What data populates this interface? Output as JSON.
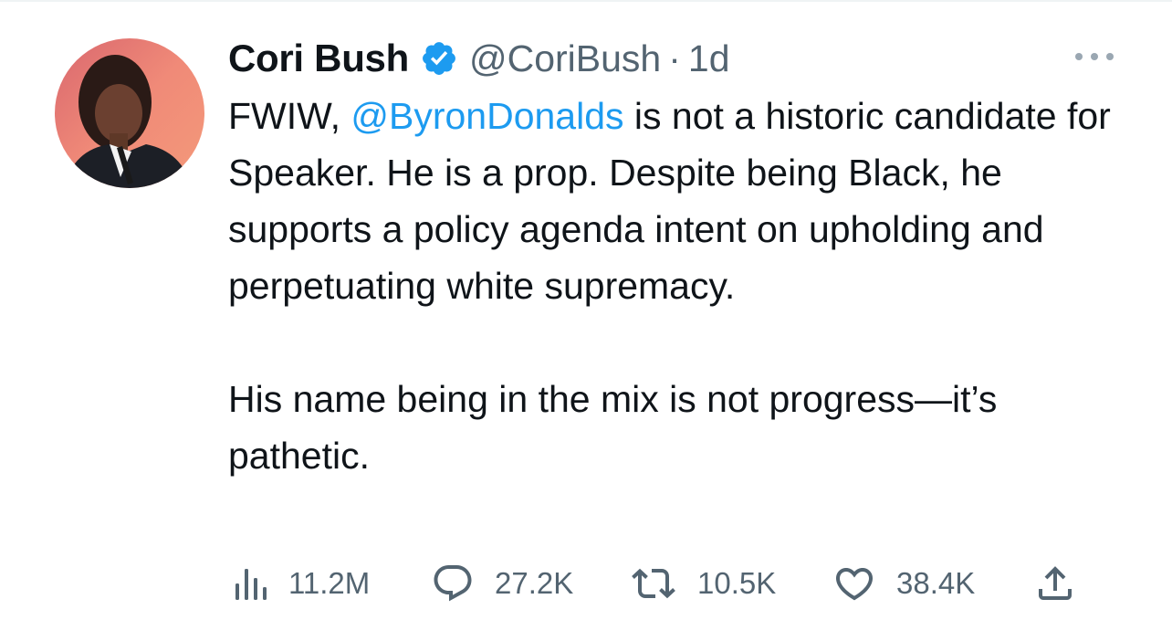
{
  "tweet": {
    "display_name": "Cori Bush",
    "handle": "@CoriBush",
    "separator": "·",
    "time": "1d",
    "text_before_mention": "FWIW, ",
    "mention": "@ByronDonalds",
    "text_after_mention": " is not a historic candidate for Speaker. He is a prop. Despite being Black, he supports a policy agenda intent on upholding and perpetuating white supremacy.",
    "paragraph2": "His name being in the mix is not progress—it’s pathetic."
  },
  "actions": {
    "views": "11.2M",
    "replies": "27.2K",
    "retweets": "10.5K",
    "likes": "38.4K"
  },
  "colors": {
    "text": "#0f1419",
    "secondary": "#536471",
    "accent": "#1d9bf0",
    "verified": "#1d9bf0"
  },
  "icons": [
    "verified-badge-icon",
    "more-icon",
    "views-icon",
    "reply-icon",
    "retweet-icon",
    "like-icon",
    "share-icon"
  ]
}
